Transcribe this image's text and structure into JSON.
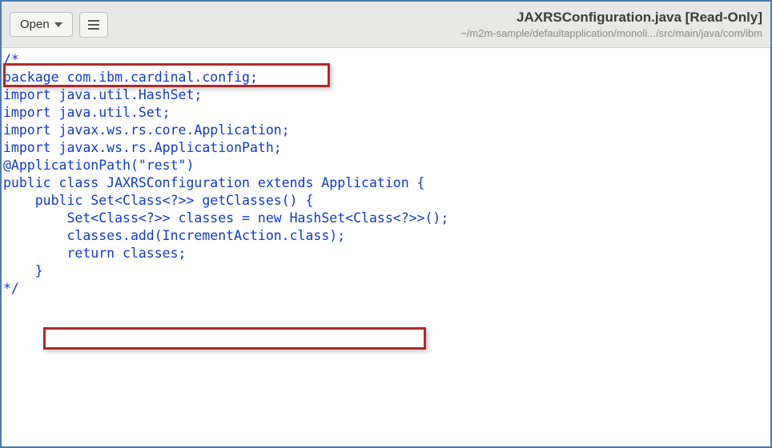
{
  "header": {
    "open_label": "Open",
    "title": "JAXRSConfiguration.java [Read-Only]",
    "subtitle": "~/m2m-sample/defaultapplication/monoli.../src/main/java/com/ibm"
  },
  "code": {
    "l01": "/*",
    "l02": "package com.ibm.cardinal.config;",
    "l03": "",
    "l04": "import java.util.HashSet;",
    "l05": "import java.util.Set;",
    "l06": "",
    "l07": "import javax.ws.rs.core.Application;",
    "l08": "import javax.ws.rs.ApplicationPath;",
    "l09": "",
    "l10": "@ApplicationPath(\"rest\")",
    "l11": "public class JAXRSConfiguration extends Application {",
    "l12": "",
    "l13": "    public Set<Class<?>> getClasses() {",
    "l14": "        Set<Class<?>> classes = new HashSet<Class<?>>();",
    "l15": "        classes.add(IncrementAction.class);",
    "l16": "        return classes;",
    "l17": "    }",
    "l18": "",
    "l19": "",
    "l20": "*/"
  }
}
